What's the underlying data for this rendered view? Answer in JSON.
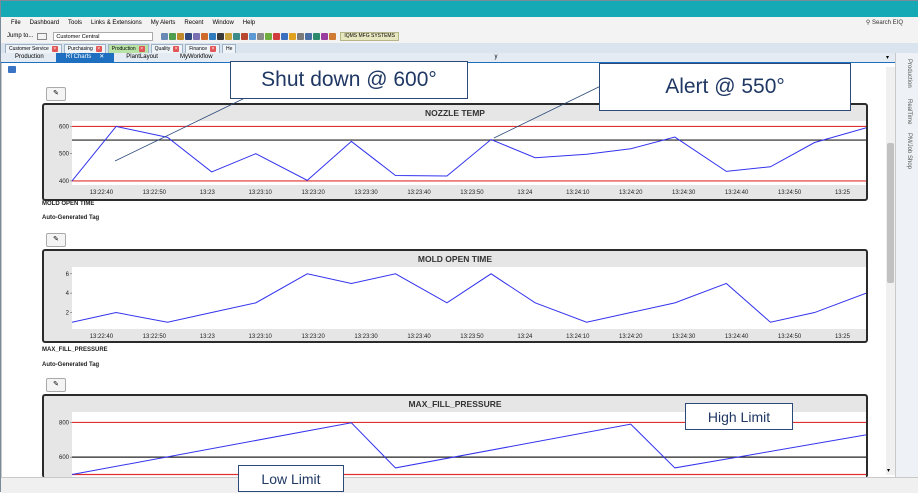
{
  "menu": [
    "File",
    "Dashboard",
    "Tools",
    "Links & Extensions",
    "My Alerts",
    "Recent",
    "Window",
    "Help"
  ],
  "search": {
    "label": "Search EIQ"
  },
  "toolbar": {
    "jump_label": "Jump to...",
    "customer_value": "Customer Central",
    "vendor_label": "IQMS MFG SYSTEMS"
  },
  "tabs_primary": [
    {
      "label": "Customer Service",
      "color": "#eef3f8"
    },
    {
      "label": "Purchasing",
      "color": "#eef3f8"
    },
    {
      "label": "Production",
      "color": "#b9e3a6"
    },
    {
      "label": "Quality",
      "color": "#eef3f8"
    },
    {
      "label": "Finance",
      "color": "#eef3f8"
    },
    {
      "label": "He",
      "color": "#eef3f8"
    }
  ],
  "tabs_secondary": [
    {
      "label": "Production",
      "active": false,
      "closable": false
    },
    {
      "label": "RTCharts",
      "active": true,
      "closable": true
    },
    {
      "label": "PlantLayout",
      "active": false,
      "closable": false
    },
    {
      "label": "MyWorkflow",
      "active": false,
      "closable": false
    },
    {
      "label": "y",
      "active": false,
      "closable": false
    }
  ],
  "side_tabs": [
    "Production",
    "RealTime",
    "PM/Job Shop"
  ],
  "charts": {
    "nozzle": {
      "title": "NOZZLE TEMP",
      "section": ""
    },
    "mold": {
      "title": "MOLD OPEN TIME",
      "section": "MOLD OPEN TIME",
      "tag": "Auto-Generated Tag"
    },
    "pressure": {
      "title": "MAX_FILL_PRESSURE",
      "section": "MAX_FILL_PRESSURE",
      "tag": "Auto-Generated Tag"
    }
  },
  "callouts": {
    "shutdown": "Shut down @ 600°",
    "alert": "Alert @ 550°",
    "high": "High Limit",
    "low": "Low Limit"
  },
  "chart_data": [
    {
      "type": "line",
      "title": "NOZZLE TEMP",
      "x": [
        "13:22:40",
        "13:22:50",
        "13:23",
        "13:23:10",
        "13:23:20",
        "13:23:30",
        "13:23:40",
        "13:23:50",
        "13:24",
        "13:24:10",
        "13:24:20",
        "13:24:30",
        "13:24:40",
        "13:24:50",
        "13:25"
      ],
      "series": [
        {
          "values": [
            400,
            600,
            560,
            433,
            500,
            402,
            545,
            420,
            418,
            552,
            485,
            498,
            518,
            561,
            435,
            452,
            541,
            595
          ]
        }
      ],
      "point_times_s": [
        0,
        6,
        13,
        19,
        25,
        32,
        38,
        44,
        51,
        57,
        63,
        70,
        76,
        82,
        89,
        95,
        101,
        108
      ],
      "yticks": [
        400,
        500,
        600
      ],
      "ylim": [
        385,
        620
      ],
      "reference_lines": [
        {
          "value": 600,
          "color": "#e03030"
        },
        {
          "value": 550,
          "color": "#222222"
        },
        {
          "value": 400,
          "color": "#e03030"
        }
      ],
      "line_color": "#3333ee"
    },
    {
      "type": "line",
      "title": "MOLD OPEN TIME",
      "x": [
        "13:22:40",
        "13:22:50",
        "13:23",
        "13:23:10",
        "13:23:20",
        "13:23:30",
        "13:23:40",
        "13:23:50",
        "13:24",
        "13:24:10",
        "13:24:20",
        "13:24:30",
        "13:24:40",
        "13:24:50",
        "13:25"
      ],
      "series": [
        {
          "values": [
            1,
            2,
            1,
            2,
            3,
            6,
            5,
            6,
            3,
            6,
            3,
            1,
            2,
            3,
            5,
            1,
            2,
            4
          ]
        }
      ],
      "point_times_s": [
        0,
        6,
        13,
        19,
        25,
        32,
        38,
        44,
        51,
        57,
        63,
        70,
        76,
        82,
        89,
        95,
        101,
        108
      ],
      "yticks": [
        2,
        4,
        6
      ],
      "ylim": [
        0.3,
        6.7
      ],
      "reference_lines": [],
      "line_color": "#3333ee"
    },
    {
      "type": "line",
      "title": "MAX_FILL_PRESSURE",
      "x": [],
      "series": [
        {
          "values": [
            500,
            798,
            538,
            790,
            538,
            728
          ]
        }
      ],
      "point_times_s": [
        0,
        38,
        44,
        76,
        82,
        108
      ],
      "yticks": [
        600,
        800
      ],
      "ylim": [
        480,
        860
      ],
      "reference_lines": [
        {
          "value": 800,
          "color": "#e03030"
        },
        {
          "value": 600,
          "color": "#222222"
        },
        {
          "value": 500,
          "color": "#e03030"
        }
      ],
      "line_color": "#3333ee"
    }
  ]
}
